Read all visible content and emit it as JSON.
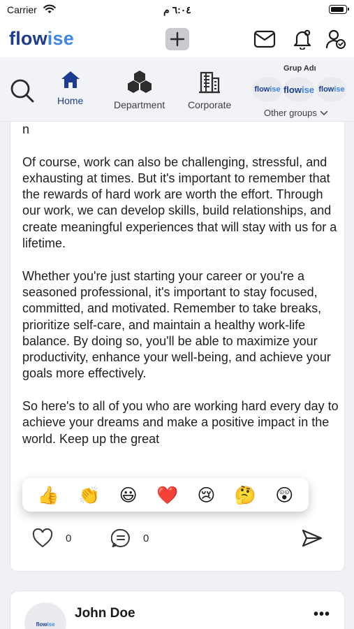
{
  "status_bar": {
    "carrier": "Carrier",
    "time": "٦:٠٤ م"
  },
  "header": {
    "brand_part1": "flow",
    "brand_part2": "ise"
  },
  "nav": {
    "items": [
      {
        "label": "Home",
        "icon": "home-icon",
        "active": true
      },
      {
        "label": "Department",
        "icon": "department-icon",
        "active": false
      },
      {
        "label": "Corporate",
        "icon": "building-icon",
        "active": false
      }
    ],
    "group_title": "Grup Adı",
    "group_logos": [
      {
        "part1": "flow",
        "part2": "ise"
      },
      {
        "part1": "flow",
        "part2": "ise"
      },
      {
        "part1": "flow",
        "part2": "ise"
      }
    ],
    "other_groups": "Other groups"
  },
  "post": {
    "body": "n\n\nOf course, work can also be challenging, stressful, and exhausting at times. But it's important to remember that the rewards of hard work are worth the effort. Through our work, we can develop skills, build relationships, and create meaningful experiences that will stay with us for a lifetime.\n\nWhether you're just starting your career or you're a seasoned professional, it's important to stay focused, committed, and motivated. Remember to take breaks, prioritize self-care, and maintain a healthy work-life balance. By doing so, you'll be able to maximize your productivity, enhance your well-being, and achieve your goals more effectively.\n\nSo here's to all of you who are working hard every day to achieve your dreams and make a positive impact in the world. Keep up the great",
    "reactions": [
      "👍",
      "👏",
      "😃",
      "❤️",
      "😢",
      "🤔",
      "😲"
    ],
    "like_count": "0",
    "comment_count": "0"
  },
  "next_post": {
    "author": "John Doe",
    "avatar_part1": "flow",
    "avatar_part2": "ise"
  }
}
